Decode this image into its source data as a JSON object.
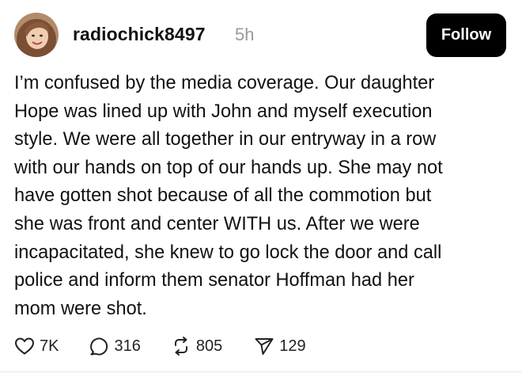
{
  "post": {
    "username": "radiochick8497",
    "time": "5h",
    "follow_label": "Follow",
    "lines": [
      "I’m confused by the media coverage. Our daughter",
      "Hope was lined up with John and myself execution",
      "style. We were all together in our entryway in a row",
      "with our hands on top of our hands up.  She may not",
      "have gotten shot because of all the commotion but",
      "she was front and center WITH us.  After we were",
      "incapacitated, she knew to go lock the door and call",
      "police and inform them senator Hoffman had her",
      "mom were shot."
    ]
  },
  "actions": {
    "likes": "7K",
    "replies": "316",
    "reposts": "805",
    "shares": "129"
  },
  "icons": {
    "like": "heart-icon",
    "reply": "speech-bubble-icon",
    "repost": "repost-arrows-icon",
    "share": "send-icon"
  }
}
